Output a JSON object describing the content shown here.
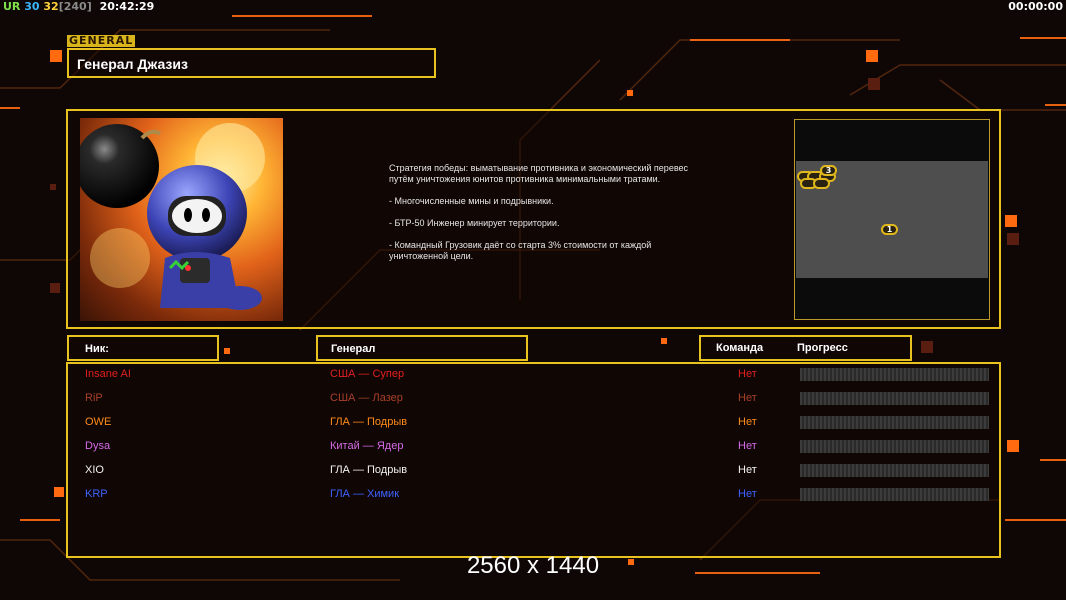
{
  "hud": {
    "ur_label": "UR",
    "fps": "30",
    "fps_target": "32",
    "rate": "[240]",
    "clock": "20:42:29",
    "timer": "00:00:00"
  },
  "general_tag": "GENERAL",
  "general_title": "Генерал Джазиз",
  "description": [
    "Стратегия победы: выматывание противника и экономический перевес путём уничтожения юнитов противника минимальными тратами.",
    "- Многочисленные мины и подрывники.",
    "- БТР-50 Инженер минирует территории.",
    "- Командный Грузовик даёт со старта 3% стоимости от каждой уничтоженной цели."
  ],
  "minimap": {
    "spawn_labels": [
      "3",
      "1"
    ]
  },
  "headers": {
    "nick": "Ник:",
    "general": "Генерал",
    "team": "Команда",
    "progress": "Прогресс"
  },
  "players": [
    {
      "nick": "Insane AI",
      "general": "США — Супер",
      "team": "Нет",
      "color": "#e02020"
    },
    {
      "nick": "RiP",
      "general": "США — Лазер",
      "team": "Нет",
      "color": "#a8402a"
    },
    {
      "nick": "OWE",
      "general": "ГЛА — Подрыв",
      "team": "Нет",
      "color": "#ff8c1a"
    },
    {
      "nick": "Dysa",
      "general": "Китай — Ядер",
      "team": "Нет",
      "color": "#d56be8"
    },
    {
      "nick": "XIO",
      "general": "ГЛА — Подрыв",
      "team": "Нет",
      "color": "#f2f2f2"
    },
    {
      "nick": "KRP",
      "general": "ГЛА — Химик",
      "team": "Нет",
      "color": "#3e62ff"
    }
  ],
  "resolution_label": "2560 x 1440",
  "colors": {
    "frame": "#e8c21f",
    "accent_orange": "#ff7a12"
  }
}
